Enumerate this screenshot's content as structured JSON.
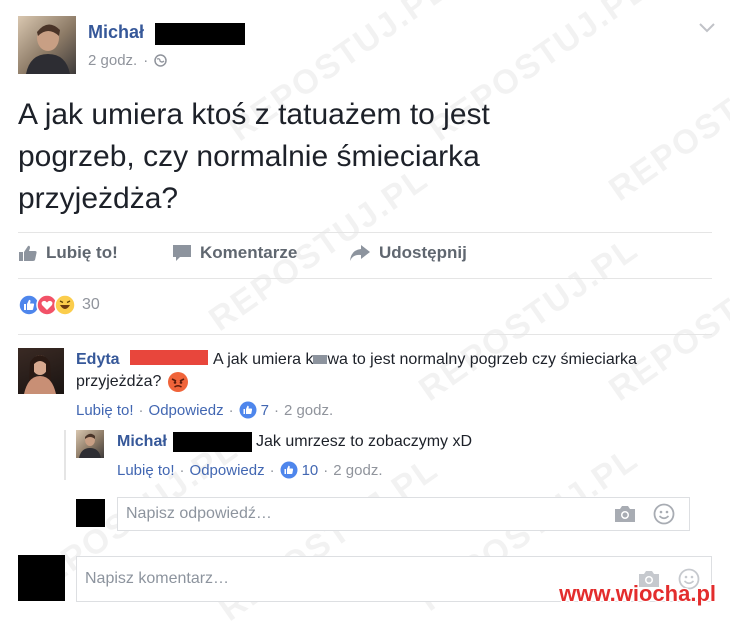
{
  "post": {
    "author": "Michał",
    "time": "2 godz.",
    "body_line1": "A jak umiera ktoś z tatuażem to jest",
    "body_line2": "pogrzeb, czy normalnie śmieciarka",
    "body_line3": "przyjeżdża?",
    "reaction_count": "30"
  },
  "actions": {
    "like": "Lubię to!",
    "comment": "Komentarze",
    "share": "Udostępnij"
  },
  "comment1": {
    "author": "Edyta",
    "text_a": "A jak umiera k",
    "text_b": "wa to jest normalny pogrzeb czy śmieciarka",
    "text_line2": "przyjeżdża?",
    "like": "Lubię to!",
    "reply": "Odpowiedz",
    "like_count": "7",
    "time": "2 godz.",
    "sep": "·"
  },
  "reply1": {
    "author": "Michał",
    "text": "Jak umrzesz to zobaczymy xD",
    "like": "Lubię to!",
    "reply": "Odpowiedz",
    "like_count": "10",
    "time": "2 godz.",
    "sep": "·"
  },
  "reply_input": {
    "placeholder": "Napisz odpowiedź…"
  },
  "comment_input": {
    "placeholder": "Napisz komentarz…"
  },
  "watermark": {
    "text": "REPOSTUJ.PL",
    "site": "www.wiocha.pl"
  },
  "colors": {
    "link": "#4267b2",
    "author": "#365899",
    "red_bar": "#e8463c"
  }
}
